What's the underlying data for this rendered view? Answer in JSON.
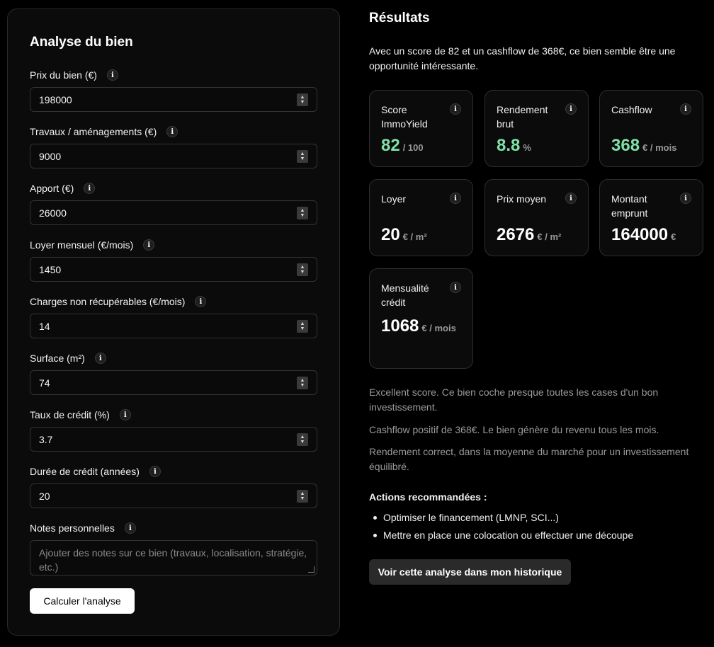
{
  "form": {
    "title": "Analyse du bien",
    "fields": [
      {
        "label": "Prix du bien (€)",
        "value": "198000"
      },
      {
        "label": "Travaux / aménagements (€)",
        "value": "9000"
      },
      {
        "label": "Apport (€)",
        "value": "26000"
      },
      {
        "label": "Loyer mensuel (€/mois)",
        "value": "1450"
      },
      {
        "label": "Charges non récupérables (€/mois)",
        "value": "14"
      },
      {
        "label": "Surface (m²)",
        "value": "74"
      },
      {
        "label": "Taux de crédit (%)",
        "value": "3.7"
      },
      {
        "label": "Durée de crédit (années)",
        "value": "20"
      }
    ],
    "notes": {
      "label": "Notes personnelles",
      "placeholder": "Ajouter des notes sur ce bien (travaux, localisation, stratégie, etc.)"
    },
    "submit_label": "Calculer l'analyse",
    "info_glyph": "i"
  },
  "results": {
    "title": "Résultats",
    "summary": "Avec un score de 82 et un cashflow de 368€, ce bien semble être une opportunité intéressante.",
    "cards": [
      {
        "label": "Score ImmoYield",
        "value": "82",
        "unit": "/ 100",
        "highlight": true
      },
      {
        "label": "Rendement brut",
        "value": "8.8",
        "unit": "%",
        "highlight": true
      },
      {
        "label": "Cashflow",
        "value": "368",
        "unit": "€ / mois",
        "highlight": true
      },
      {
        "label": "Loyer",
        "value": "20",
        "unit": "€ / m²",
        "highlight": false
      },
      {
        "label": "Prix moyen",
        "value": "2676",
        "unit": "€ / m²",
        "highlight": false
      },
      {
        "label": "Montant emprunt",
        "value": "164000",
        "unit": "€",
        "highlight": false
      },
      {
        "label": "Mensualité crédit",
        "value": "1068",
        "unit": "€ / mois",
        "highlight": false
      }
    ],
    "descriptions": [
      "Excellent score. Ce bien coche presque toutes les cases d'un bon investissement.",
      "Cashflow positif de 368€. Le bien génère du revenu tous les mois.",
      "Rendement correct, dans la moyenne du marché pour un investissement équilibré."
    ],
    "actions_title": "Actions recommandées :",
    "actions": [
      "Optimiser le financement (LMNP, SCI...)",
      "Mettre en place une colocation ou effectuer une découpe"
    ],
    "history_button_label": "Voir cette analyse dans mon historique"
  },
  "colors": {
    "accent_green": "#7ee2a8",
    "background": "#000000",
    "panel": "#0b0b0b"
  }
}
